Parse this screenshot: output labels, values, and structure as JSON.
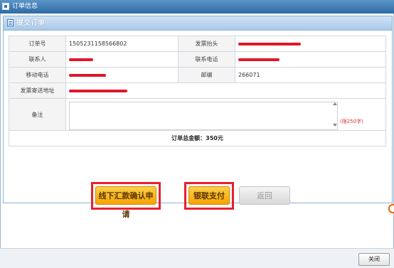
{
  "window": {
    "title": "订单信息"
  },
  "panel": {
    "title": "提交订单"
  },
  "order": {
    "order_no_label": "订单号",
    "order_no": "1505231158566802",
    "invoice_title_label": "发票抬头",
    "contact_label": "联系人",
    "contact_phone_label": "联系电话",
    "mobile_label": "移动电话",
    "postcode_label": "邮编",
    "postcode": "266071",
    "address_label": "发票寄送地址",
    "remark_label": "备注",
    "remark_value": "",
    "remark_limit": "(限250字)",
    "total_label": "订单总金额：",
    "total_amount": "350元"
  },
  "buttons": {
    "offline": "线下汇款确认申请",
    "unionpay": "银联支付",
    "back": "返回"
  },
  "footer": {
    "close": "关闭"
  },
  "colors": {
    "accent": "#f6a400",
    "highlight": "#e8202c",
    "titlebar": "#3c78b3"
  }
}
